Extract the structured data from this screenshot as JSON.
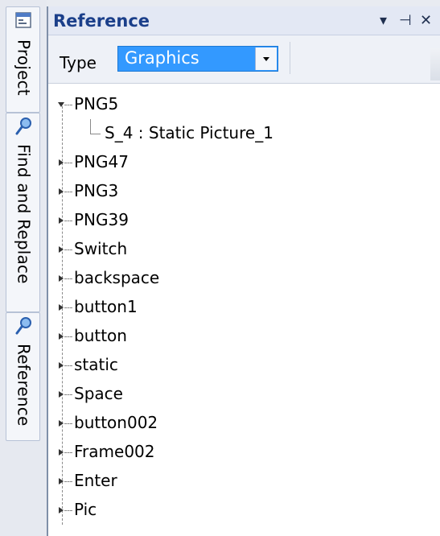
{
  "side_tabs": [
    {
      "label": "Project",
      "icon": "project-icon"
    },
    {
      "label": "Find and Replace",
      "icon": "search-icon"
    },
    {
      "label": "Reference",
      "icon": "search-icon"
    }
  ],
  "panel": {
    "title": "Reference",
    "controls": {
      "dropdown": "▾",
      "pin": "⊣",
      "close": "✕"
    }
  },
  "toolbar": {
    "type_label": "Type",
    "type_value": "Graphics"
  },
  "tree": {
    "expanded_item": {
      "label": "PNG5",
      "children": [
        "S_4 : Static Picture_1"
      ]
    },
    "items": [
      "PNG47",
      "PNG3",
      "PNG39",
      "Switch",
      "backspace",
      "button1",
      "button",
      "static",
      "Space",
      "button002",
      "Frame002",
      "Enter",
      "Pic"
    ]
  },
  "colors": {
    "accent": "#3399ff",
    "title": "#1b3f8a"
  }
}
